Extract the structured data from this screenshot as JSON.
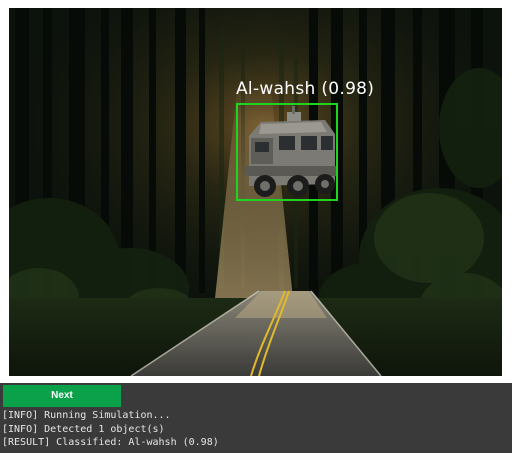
{
  "detection": {
    "label": "Al-wahsh (0.98)",
    "box_color": "#1ed41e"
  },
  "controls": {
    "next_label": "Next",
    "accent": "#0aa14a"
  },
  "log": {
    "lines": [
      "[INFO] Running Simulation...",
      "[INFO] Detected 1 object(s)",
      "[RESULT] Classified: Al-wahsh (0.98)"
    ]
  },
  "colors": {
    "panel_bg": "#3a3a3a",
    "log_text": "#e6e6e6"
  }
}
